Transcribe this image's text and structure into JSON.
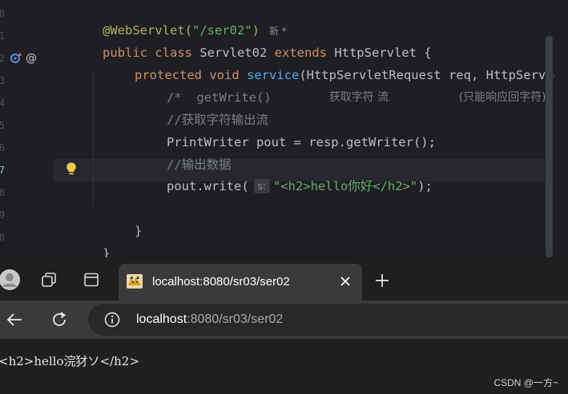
{
  "editor": {
    "line_numbers": [
      "0",
      "1",
      "2",
      "3",
      "4",
      "5",
      "6",
      "7",
      "8",
      "9",
      "0"
    ],
    "line1": {
      "annotation": "@WebServlet(",
      "path": "\"/ser02\"",
      "close": ")",
      "badge": "新 *"
    },
    "line2": {
      "kw1": "public class ",
      "name": "Servlet02 ",
      "kw2": "extends ",
      "parent": "HttpServlet {"
    },
    "line3": {
      "kw": "protected void ",
      "method": "service",
      "params": "(HttpServletRequest req, HttpServlet"
    },
    "line4": {
      "prefix": "/*  getWrite()",
      "mid": "获取字符 流",
      "right": "(只能响应回字符)"
    },
    "line5": "//获取字符输出流",
    "line6": "PrintWriter pout = resp.getWriter();",
    "line7": "//输出数据",
    "line8": {
      "call": "pout.write(",
      "hint": "s:",
      "arg": "\"<h2>hello你好</h2>\"",
      "end": ");"
    },
    "close_brace_method": "}",
    "close_brace_class": "}",
    "colors": {
      "keyword": "#cf8e6d",
      "annotation": "#b3ae60",
      "string": "#6aab73",
      "method": "#56a8f5",
      "comment": "#7a7e85"
    }
  },
  "browser": {
    "tab": {
      "title": "localhost:8080/sr03/ser02",
      "favicon": "tomcat-icon"
    },
    "address": {
      "host": "localhost",
      "rest": ":8080/sr03/ser02"
    },
    "page_text": "<h2>hello浣犲ソ</h2>",
    "icons": {
      "profile": "profile-avatar-icon",
      "workspaces": "workspaces-icon",
      "tab_actions": "tab-actions-icon",
      "close": "close-icon",
      "new_tab": "plus-icon",
      "back": "back-arrow-icon",
      "reload": "reload-icon",
      "site_info": "info-icon"
    }
  },
  "watermark": "CSDN @一方~"
}
